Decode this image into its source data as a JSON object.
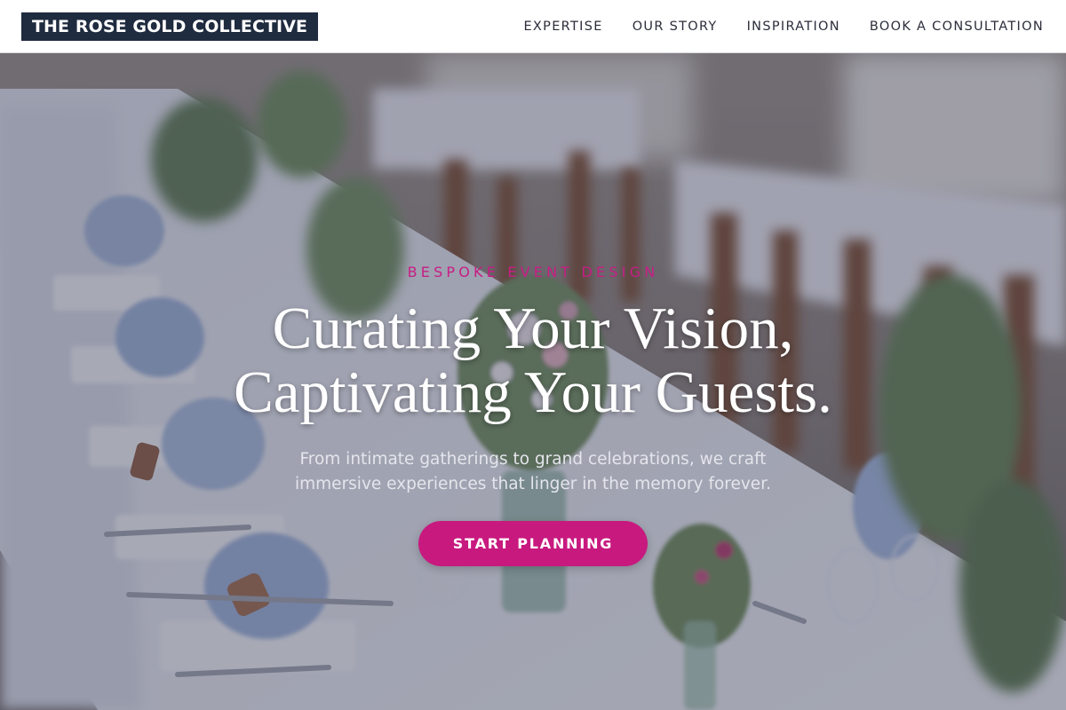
{
  "brand": {
    "logo_text": "THE ROSE GOLD COLLECTIVE"
  },
  "nav": {
    "items": [
      {
        "label": "EXPERTISE"
      },
      {
        "label": "OUR STORY"
      },
      {
        "label": "INSPIRATION"
      },
      {
        "label": "BOOK A CONSULTATION"
      }
    ]
  },
  "hero": {
    "eyebrow": "BESPOKE EVENT DESIGN",
    "headline_line1": "Curating Your Vision,",
    "headline_line2": "Captivating Your Guests.",
    "subhead_line1": "From intimate gatherings to grand celebrations, we craft",
    "subhead_line2": "immersive experiences that linger in the memory forever.",
    "cta_label": "START PLANNING"
  },
  "colors": {
    "accent": "#c8197f",
    "logo_background": "#1f2b3f",
    "header_background": "#ffffff",
    "hero_overlay": "#3a3f58"
  }
}
